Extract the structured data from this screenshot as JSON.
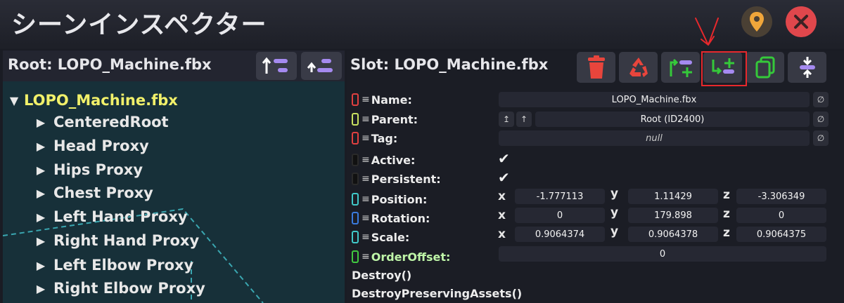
{
  "window": {
    "title": "シーンインスペクター"
  },
  "hierarchy": {
    "root_label": "Root: LOPO_Machine.fbx",
    "root_item": "LOPO_Machine.fbx",
    "items": [
      {
        "label": "CenteredRoot"
      },
      {
        "label": "Head Proxy"
      },
      {
        "label": "Hips Proxy"
      },
      {
        "label": "Chest Proxy"
      },
      {
        "label": "Left Hand Proxy"
      },
      {
        "label": "Right Hand Proxy"
      },
      {
        "label": "Left Elbow Proxy"
      },
      {
        "label": "Right Elbow Proxy"
      }
    ]
  },
  "slot": {
    "label": "Slot: LOPO_Machine.fbx",
    "toolbar_icons": [
      "trash-icon",
      "recycle-icon",
      "insert-parent-icon",
      "add-child-icon",
      "duplicate-icon",
      "center-icon"
    ]
  },
  "properties": {
    "name_label": "Name:",
    "name_value": "LOPO_Machine.fbx",
    "parent_label": "Parent:",
    "parent_value": "Root (ID2400)",
    "parent_btn_1": "↥",
    "parent_btn_2": "↑",
    "tag_label": "Tag:",
    "tag_value": "null",
    "active_label": "Active:",
    "persistent_label": "Persistent:",
    "position_label": "Position:",
    "position": {
      "x": "-1.777113",
      "y": "1.11429",
      "z": "-3.306349"
    },
    "rotation_label": "Rotation:",
    "rotation": {
      "x": "0",
      "y": "179.898",
      "z": "0"
    },
    "scale_label": "Scale:",
    "scale": {
      "x": "0.9064374",
      "y": "0.9064378",
      "z": "0.9064375"
    },
    "orderoffset_label": "OrderOffset:",
    "orderoffset_value": "0",
    "axis_x": "x",
    "axis_y": "y",
    "axis_z": "z",
    "null_btn": "∅",
    "check": "✔"
  },
  "methods": [
    "Destroy()",
    "DestroyPreservingAssets()"
  ],
  "colors": {
    "title_bg": "#1d1f27",
    "tree_bg": "#173039",
    "root_item": "#f1f06a",
    "close": "#e0474c",
    "trash": "#e8453c",
    "green": "#35c93a",
    "purple": "#a58af0",
    "highlight": "#e8282c"
  }
}
